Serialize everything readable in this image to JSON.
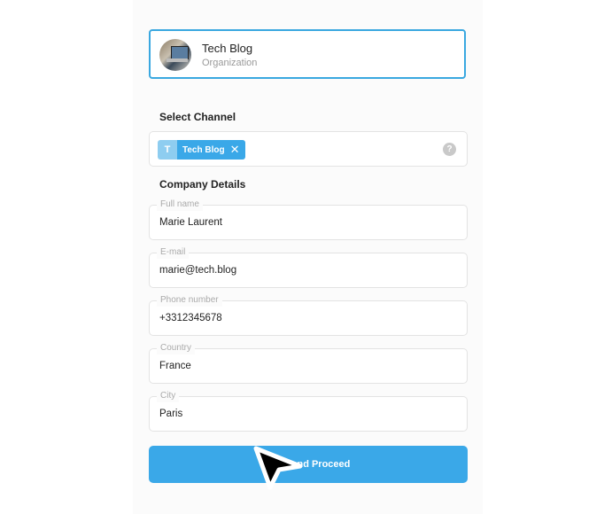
{
  "organization": {
    "name": "Tech Blog",
    "type": "Organization"
  },
  "channel": {
    "title": "Select Channel",
    "selected": [
      {
        "initial": "T",
        "label": "Tech Blog",
        "remove_icon": "close-icon"
      }
    ],
    "help_icon": "?"
  },
  "company": {
    "title": "Company Details",
    "fields": [
      {
        "label": "Full name",
        "value": "Marie Laurent"
      },
      {
        "label": "E-mail",
        "value": "marie@tech.blog"
      },
      {
        "label": "Phone number",
        "value": "+3312345678"
      },
      {
        "label": "Country",
        "value": "France"
      },
      {
        "label": "City",
        "value": "Paris"
      }
    ]
  },
  "submit": {
    "label": "Save and Proceed"
  },
  "colors": {
    "accent": "#3aa8e8",
    "chip_initial": "#8ecdf0"
  }
}
